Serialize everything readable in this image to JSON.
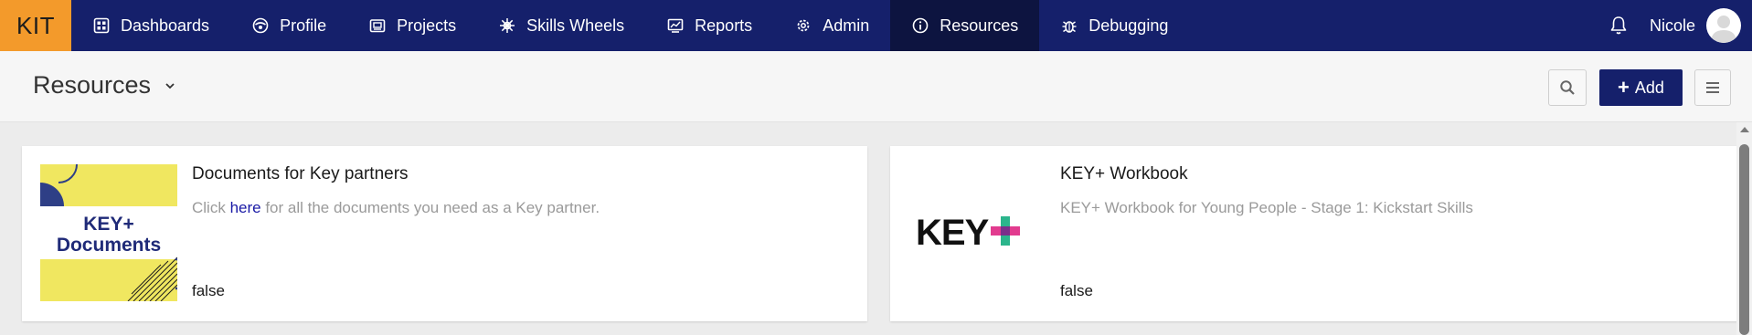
{
  "brand": {
    "label": "KIT",
    "color": "#f39a2b"
  },
  "nav": {
    "bg_color": "#15206b",
    "items": [
      {
        "label": "Dashboards",
        "icon": "dashboard-icon"
      },
      {
        "label": "Profile",
        "icon": "profile-icon"
      },
      {
        "label": "Projects",
        "icon": "projects-icon"
      },
      {
        "label": "Skills Wheels",
        "icon": "wheel-icon"
      },
      {
        "label": "Reports",
        "icon": "reports-icon"
      },
      {
        "label": "Admin",
        "icon": "gear-icon"
      },
      {
        "label": "Resources",
        "icon": "info-icon",
        "active": true
      },
      {
        "label": "Debugging",
        "icon": "bug-icon"
      }
    ],
    "user": {
      "name": "Nicole"
    }
  },
  "header": {
    "title": "Resources",
    "add_label": "Add"
  },
  "resources": [
    {
      "title": "Documents for Key partners",
      "desc_before": "Click ",
      "desc_link": "here",
      "desc_after": " for all the documents you need as a Key partner.",
      "flag": "false",
      "thumb_text_1": "KEY+",
      "thumb_text_2": "Documents"
    },
    {
      "title": "KEY+ Workbook",
      "description": "KEY+ Workbook for Young People - Stage 1: Kickstart Skills",
      "flag": "false",
      "logo_text": "KEY"
    }
  ]
}
